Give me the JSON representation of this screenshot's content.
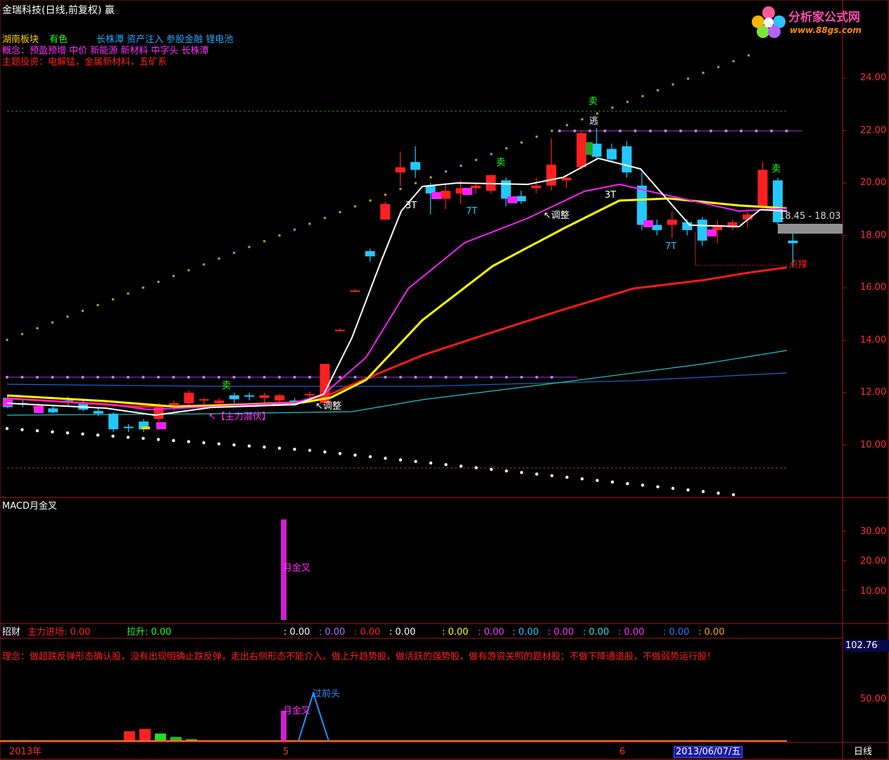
{
  "window_title": "金瑞科技(日线,前复权) 赢",
  "watermark": {
    "line1": "分析家公式网",
    "line2": "www.88gs.com"
  },
  "info_lines": {
    "sector_label": "湖南板块",
    "sector_value": "有色",
    "sector_tags": "长株潭 资产注入 参股金融 锂电池",
    "concepts": "概念：预盈预增 中价 新能源 新材料 中字头 长株潭",
    "themes": "主题投资：电解锰，金属新材料，五矿系"
  },
  "price_axis": {
    "labels": [
      "24.00",
      "22.00",
      "20.00",
      "18.00",
      "16.00",
      "14.00",
      "12.00",
      "10.00"
    ]
  },
  "price_range_label": "18.45 - 18.03",
  "annotations": {
    "sell": "卖",
    "escape": "逃",
    "t3": "3T",
    "t7": "7T",
    "adjust": "↖调整",
    "main_force": "↖【主力潜伏】",
    "point_strike": "点撑"
  },
  "macd_panel": {
    "title": "MACD月金叉",
    "bar_label": "月金叉",
    "axis": [
      "30.00",
      "20.00",
      "10.00"
    ]
  },
  "indicator_panel": {
    "name": "招财",
    "main_force_entry": "主力进场: 0.00",
    "lift": "拉升: 0.00",
    "values": [
      ": 0.00",
      ": 0.00",
      ": 0.00",
      ": 0.00",
      ": 0.00",
      ": 0.00",
      ": 0.00",
      ": 0.00",
      ": 0.00",
      ": 0.00",
      ": 0.00",
      ": 0.00"
    ],
    "philosophy": "理念：做超跌反弹形态确认股，没有出现明确止跌反弹，走出右侧形态不能介入。做上升趋势股，做活跃的强势股，做有游资关照的题材股；不做下降通道股，不做弱势运行股！",
    "axis": [
      "100.0",
      "50.00"
    ],
    "current_value": "102.76",
    "cross_label": "月金叉",
    "over_prev_high": "过前头"
  },
  "date_axis": {
    "year": "2013年",
    "may": "5",
    "june": "6",
    "cursor_date": "2013/06/07/五"
  },
  "period_button": "日线",
  "chart_data": {
    "type": "candlestick",
    "title": "金瑞科技(日线,前复权)",
    "ylim": [
      8.5,
      25.5
    ],
    "colors": {
      "up": "#ff2020",
      "down": "#22c8ff",
      "ma_white": "#ffffff",
      "ma_magenta": "#ff20ff",
      "ma_yellow": "#ffff00",
      "ma_red": "#ff1a1a"
    },
    "candles": [
      {
        "o": 11.8,
        "h": 11.9,
        "l": 11.4,
        "c": 11.45
      },
      {
        "o": 11.6,
        "h": 11.75,
        "l": 11.45,
        "c": 11.55
      },
      {
        "o": 11.5,
        "h": 11.6,
        "l": 11.35,
        "c": 11.5
      },
      {
        "o": 11.4,
        "h": 11.5,
        "l": 11.2,
        "c": 11.25
      },
      {
        "o": 11.7,
        "h": 11.85,
        "l": 11.5,
        "c": 11.65
      },
      {
        "o": 11.6,
        "h": 11.7,
        "l": 11.3,
        "c": 11.35
      },
      {
        "o": 11.3,
        "h": 11.4,
        "l": 11.1,
        "c": 11.2
      },
      {
        "o": 11.2,
        "h": 11.25,
        "l": 10.5,
        "c": 10.6
      },
      {
        "o": 10.7,
        "h": 10.8,
        "l": 10.5,
        "c": 10.65
      },
      {
        "o": 10.9,
        "h": 11.0,
        "l": 10.5,
        "c": 10.6
      },
      {
        "o": 11.0,
        "h": 11.6,
        "l": 10.9,
        "c": 11.5
      },
      {
        "o": 11.5,
        "h": 11.7,
        "l": 11.3,
        "c": 11.6
      },
      {
        "o": 11.6,
        "h": 12.1,
        "l": 11.5,
        "c": 12.0
      },
      {
        "o": 11.7,
        "h": 11.8,
        "l": 11.5,
        "c": 11.75
      },
      {
        "o": 11.6,
        "h": 11.8,
        "l": 11.5,
        "c": 11.7
      },
      {
        "o": 11.9,
        "h": 12.0,
        "l": 11.6,
        "c": 11.75
      },
      {
        "o": 11.9,
        "h": 12.0,
        "l": 11.7,
        "c": 11.85
      },
      {
        "o": 11.8,
        "h": 12.0,
        "l": 11.6,
        "c": 11.9
      },
      {
        "o": 11.7,
        "h": 11.95,
        "l": 11.6,
        "c": 11.9
      },
      {
        "o": 11.7,
        "h": 11.8,
        "l": 11.5,
        "c": 11.6
      },
      {
        "o": 11.9,
        "h": 12.05,
        "l": 11.7,
        "c": 11.95
      },
      {
        "o": 11.6,
        "h": 13.1,
        "l": 11.6,
        "c": 13.1
      },
      {
        "o": 14.4,
        "h": 14.45,
        "l": 14.35,
        "c": 14.4
      },
      {
        "o": 15.9,
        "h": 15.95,
        "l": 15.85,
        "c": 15.9
      },
      {
        "o": 17.4,
        "h": 17.5,
        "l": 17.0,
        "c": 17.2
      },
      {
        "o": 18.6,
        "h": 19.3,
        "l": 18.6,
        "c": 19.2
      },
      {
        "o": 20.4,
        "h": 21.2,
        "l": 19.9,
        "c": 20.6
      },
      {
        "o": 20.8,
        "h": 21.4,
        "l": 20.2,
        "c": 20.5
      },
      {
        "o": 19.9,
        "h": 20.0,
        "l": 18.8,
        "c": 19.6
      },
      {
        "o": 19.4,
        "h": 20.0,
        "l": 19.0,
        "c": 19.7
      },
      {
        "o": 19.6,
        "h": 20.1,
        "l": 19.2,
        "c": 19.8
      },
      {
        "o": 19.8,
        "h": 20.0,
        "l": 19.6,
        "c": 19.9
      },
      {
        "o": 19.7,
        "h": 20.3,
        "l": 19.6,
        "c": 20.3
      },
      {
        "o": 20.1,
        "h": 20.2,
        "l": 19.1,
        "c": 19.4
      },
      {
        "o": 19.5,
        "h": 19.7,
        "l": 19.2,
        "c": 19.3
      },
      {
        "o": 19.8,
        "h": 20.2,
        "l": 19.6,
        "c": 19.9
      },
      {
        "o": 19.9,
        "h": 21.7,
        "l": 19.7,
        "c": 20.7
      },
      {
        "o": 20.1,
        "h": 20.3,
        "l": 19.8,
        "c": 20.2
      },
      {
        "o": 20.6,
        "h": 22.0,
        "l": 20.5,
        "c": 21.9
      },
      {
        "o": 21.5,
        "h": 22.1,
        "l": 20.9,
        "c": 21.0
      },
      {
        "o": 21.3,
        "h": 21.5,
        "l": 20.8,
        "c": 20.9
      },
      {
        "o": 21.4,
        "h": 21.6,
        "l": 20.2,
        "c": 20.4
      },
      {
        "o": 19.9,
        "h": 20.4,
        "l": 18.2,
        "c": 18.4
      },
      {
        "o": 18.4,
        "h": 18.6,
        "l": 18.0,
        "c": 18.2
      },
      {
        "o": 18.4,
        "h": 18.9,
        "l": 17.9,
        "c": 18.6
      },
      {
        "o": 18.5,
        "h": 18.6,
        "l": 18.0,
        "c": 18.2
      },
      {
        "o": 18.6,
        "h": 18.7,
        "l": 17.6,
        "c": 17.8
      },
      {
        "o": 18.2,
        "h": 18.6,
        "l": 17.7,
        "c": 18.4
      },
      {
        "o": 18.3,
        "h": 18.6,
        "l": 18.2,
        "c": 18.5
      },
      {
        "o": 18.6,
        "h": 18.9,
        "l": 18.3,
        "c": 18.8
      },
      {
        "o": 19.1,
        "h": 20.8,
        "l": 19.0,
        "c": 20.5
      },
      {
        "o": 20.1,
        "h": 20.2,
        "l": 18.4,
        "c": 18.5
      },
      {
        "o": 17.8,
        "h": 18.1,
        "l": 16.8,
        "c": 17.7
      }
    ],
    "macd_bar_value": 34.0,
    "lower_bars": [
      {
        "value": 8,
        "color": "#ff2020"
      },
      {
        "value": 10,
        "color": "#ff2020"
      },
      {
        "value": 6,
        "color": "#20e020"
      },
      {
        "value": 3,
        "color": "#20c020"
      },
      {
        "value": 1,
        "color": "#20c020"
      }
    ]
  }
}
